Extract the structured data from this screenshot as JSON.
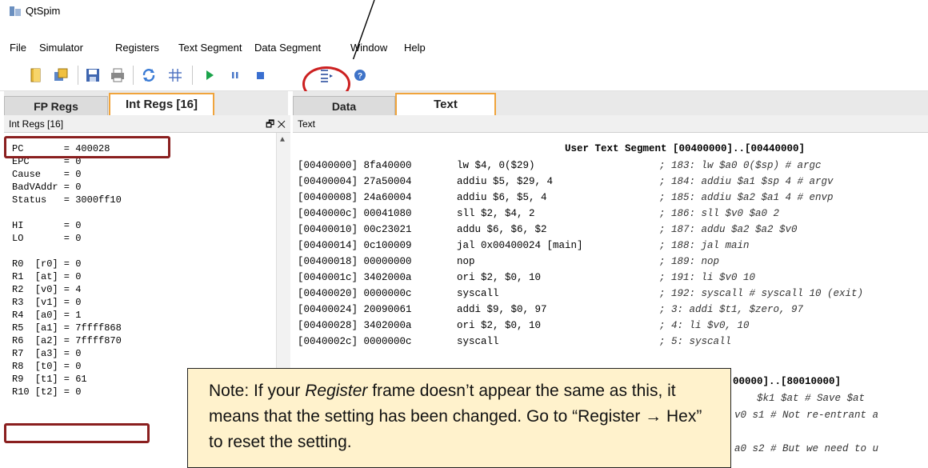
{
  "window": {
    "title": "QtSpim"
  },
  "menu": [
    "File",
    "Simulator",
    "Registers",
    "Text Segment",
    "Data Segment",
    "Window",
    "Help"
  ],
  "toolbar": {
    "icons": [
      "open-icon",
      "reload-icon",
      "save-icon",
      "print-icon",
      "clear-icon",
      "grid-icon",
      "run-icon",
      "pause-icon",
      "stop-icon",
      "single-step-icon",
      "help-icon"
    ]
  },
  "left_tabs": {
    "fp": "FP Regs",
    "int": "Int Regs [16]"
  },
  "right_tabs": {
    "data": "Data",
    "text": "Text"
  },
  "left_dock_title": "Int Regs [16]",
  "right_dock_title": "Text",
  "dock_buttons": "🗗 ✕",
  "registers": [
    "PC       = 400028",
    "EPC      = 0",
    "Cause    = 0",
    "BadVAddr = 0",
    "Status   = 3000ff10",
    "",
    "HI       = 0",
    "LO       = 0",
    "",
    "R0  [r0] = 0",
    "R1  [at] = 0",
    "R2  [v0] = 4",
    "R3  [v1] = 0",
    "R4  [a0] = 1",
    "R5  [a1] = 7ffff868",
    "R6  [a2] = 7ffff870",
    "R7  [a3] = 0",
    "R8  [t0] = 0",
    "R9  [t1] = 61",
    "R10 [t2] = 0"
  ],
  "text_segment": {
    "header": "User Text Segment [00400000]..[00440000]",
    "rows": [
      {
        "addr": "[00400000] 8fa40000",
        "code": "lw $4, 0($29)",
        "comment": "; 183: lw $a0 0($sp) # argc"
      },
      {
        "addr": "[00400004] 27a50004",
        "code": "addiu $5, $29, 4",
        "comment": "; 184: addiu $a1 $sp 4 # argv"
      },
      {
        "addr": "[00400008] 24a60004",
        "code": "addiu $6, $5, 4",
        "comment": "; 185: addiu $a2 $a1 4 # envp"
      },
      {
        "addr": "[0040000c] 00041080",
        "code": "sll $2, $4, 2",
        "comment": "; 186: sll $v0 $a0 2"
      },
      {
        "addr": "[00400010] 00c23021",
        "code": "addu $6, $6, $2",
        "comment": "; 187: addu $a2 $a2 $v0"
      },
      {
        "addr": "[00400014] 0c100009",
        "code": "jal 0x00400024 [main]",
        "comment": "; 188: jal main"
      },
      {
        "addr": "[00400018] 00000000",
        "code": "nop",
        "comment": "; 189: nop"
      },
      {
        "addr": "[0040001c] 3402000a",
        "code": "ori $2, $0, 10",
        "comment": "; 191: li $v0 10"
      },
      {
        "addr": "[00400020] 0000000c",
        "code": "syscall",
        "comment": "; 192: syscall # syscall 10 (exit)"
      },
      {
        "addr": "[00400024] 20090061",
        "code": "addi $9, $0, 97",
        "comment": "; 3: addi $t1, $zero, 97"
      },
      {
        "addr": "[00400028] 3402000a",
        "code": "ori $2, $0, 10",
        "comment": "; 4: li $v0, 10"
      },
      {
        "addr": "[0040002c] 0000000c",
        "code": "syscall",
        "comment": "; 5: syscall"
      }
    ],
    "kernel_header_fragment": "00000]..[80010000]",
    "kernel_fragments": [
      "$k1 $at # Save $at",
      "v0 s1 # Not re-entrant a",
      "a0 s2 # But we need to u"
    ]
  },
  "note": {
    "prefix": "Note: If your ",
    "italic": "Register",
    "rest1": " frame doesn’t appear the same as this, it means that the setting has been changed. Go to “Register ",
    "arrow": "→",
    "rest2": " Hex” to reset the setting."
  },
  "colors": {
    "tab_accent": "#f0a43c",
    "highlight_box": "#8a1f1f",
    "circle": "#cc2020",
    "note_bg": "#fff2cc"
  }
}
